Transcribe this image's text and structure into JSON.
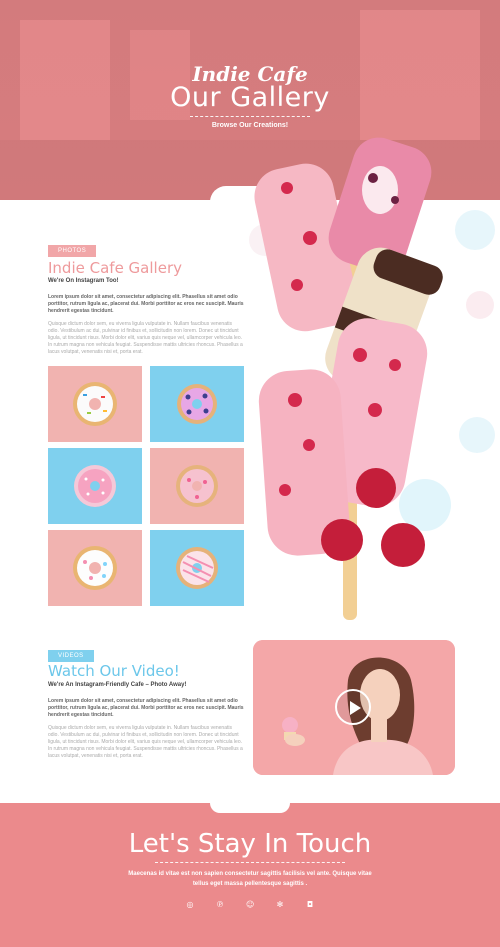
{
  "hero": {
    "brand": "Indie Cafe",
    "title": "Our Gallery",
    "subtitle": "Browse Our Creations!"
  },
  "gallery_section": {
    "tag": "PHOTOS",
    "title": "Indie Cafe Gallery",
    "subtitle": "We're On Instagram Too!",
    "para_bold": "Lorem ipsum dolor sit amet, consectetur adipiscing elit. Phasellus sit amet odio porttitor, rutrum ligula ac, placerat dui. Morbi porttitor ac eros nec suscipit. Mauris hendrerit egestas tincidunt.",
    "para": "Quisque dictum dolor sem, eu viverra ligula vulputate in. Nullam faucibus venenatis odio. Vestibulum ac dui, pulvinar id finibus et, sollicitudin non lorem. Donec ut tincidunt ligula, ut tincidunt risus. Morbi dolor elit, varius quis neque vel, ullamcorper vehicula leo. In rutrum magna non vehicula feugiat. Suspendisse mattis ultricies rhoncus. Phasellus a lacus volutpat, venenatis nisi et, porta erat."
  },
  "gallery_tiles": [
    {
      "bg": "pink",
      "donut": "white-sprinkle"
    },
    {
      "bg": "blue",
      "donut": "purple-blueberry"
    },
    {
      "bg": "blue",
      "donut": "pink-sprinkle"
    },
    {
      "bg": "pink",
      "donut": "pink-dot"
    },
    {
      "bg": "pink",
      "donut": "white-star"
    },
    {
      "bg": "blue",
      "donut": "pink-drizzle"
    }
  ],
  "video_section": {
    "tag": "VIDEOS",
    "title": "Watch Our Video!",
    "subtitle": "We're An Instagram-Friendly Cafe – Photo Away!",
    "para_bold": "Lorem ipsum dolor sit amet, consectetur adipiscing elit. Phasellus sit amet odio porttitor, rutrum ligula ac, placerat dui. Morbi porttitor ac eros nec suscipit. Mauris hendrerit egestas tincidunt.",
    "para": "Quisque dictum dolor sem, eu viverra ligula vulputate in. Nullam faucibus venenatis odio. Vestibulum ac dui, pulvinar id finibus et, sollicitudin non lorem. Donec ut tincidunt ligula, ut tincidunt risus. Morbi dolor elit, varius quis neque vel, ullamcorper vehicula leo. In rutrum magna non vehicula feugiat. Suspendisse mattis ultricies rhoncus. Phasellus a lacus volutpat, venenatis nisi et, porta erat."
  },
  "footer": {
    "title": "Let's Stay In Touch",
    "text": "Maecenas id vitae  est non sapien consectetur sagittis facilisis vel ante. Quisque vitae tellus eget massa pellentesque sagittis .",
    "socials": [
      {
        "name": "instagram-icon",
        "glyph": "◎"
      },
      {
        "name": "pinterest-icon",
        "glyph": "℗"
      },
      {
        "name": "snapchat-icon",
        "glyph": "☺"
      },
      {
        "name": "yelp-icon",
        "glyph": "✻"
      },
      {
        "name": "flickr-icon",
        "glyph": "◘"
      }
    ]
  },
  "colors": {
    "brand_pink": "#ec8b8e",
    "accent_blue": "#7fd0ee",
    "tile_pink": "#f1b3b0"
  }
}
